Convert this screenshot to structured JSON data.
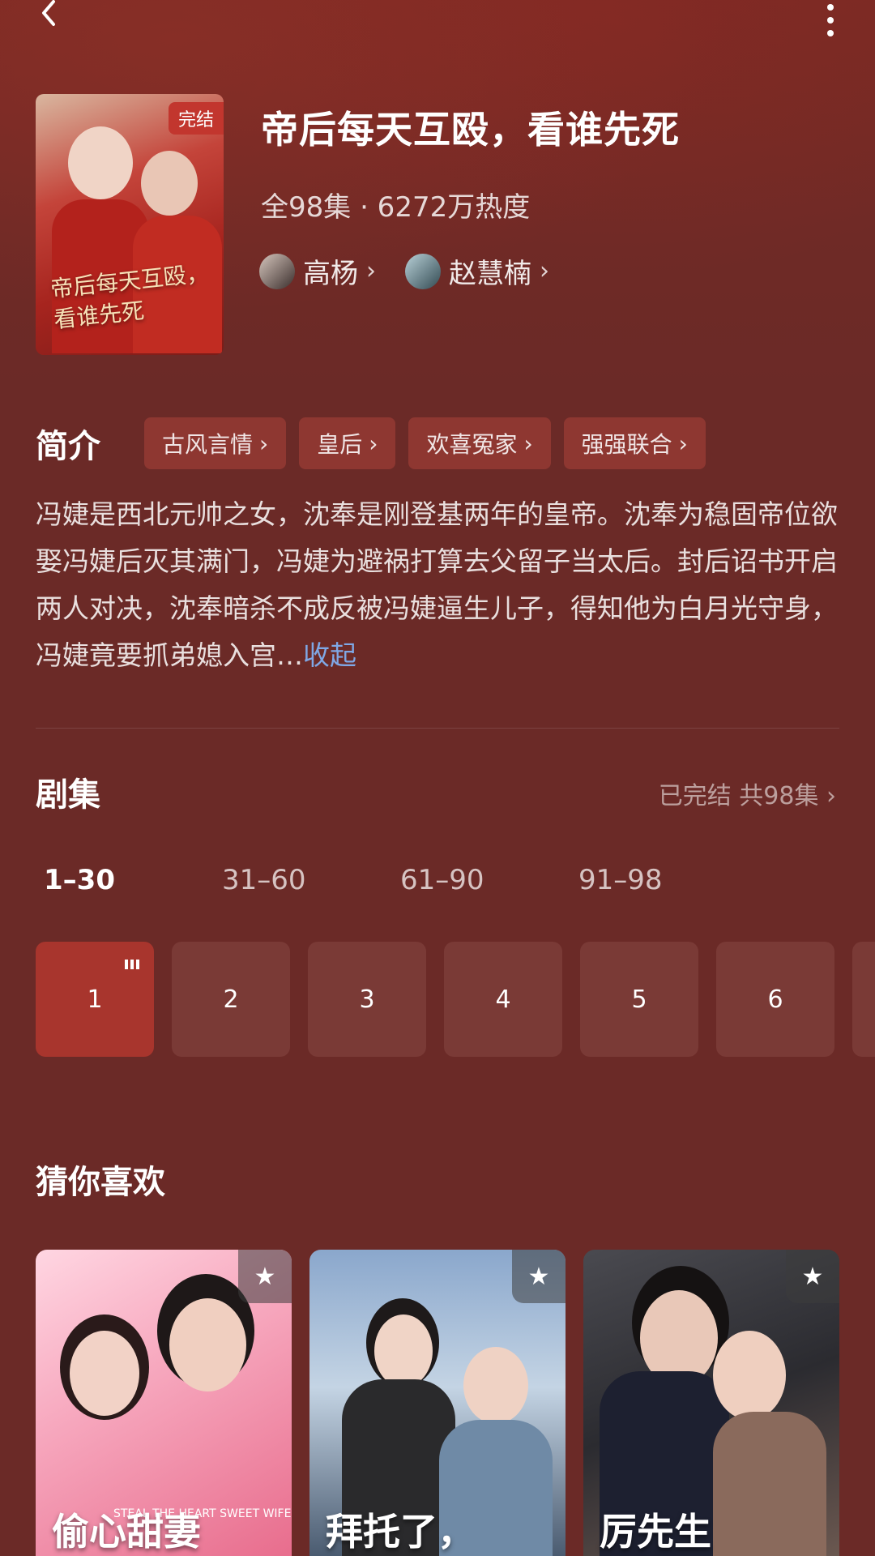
{
  "drama": {
    "title": "帝后每天互殴，看谁先死",
    "meta": "全98集 · 6272万热度",
    "badge": "完结",
    "poster_calligraphy": "帝后每天互殴，看谁先死",
    "actors": [
      {
        "name": "高杨"
      },
      {
        "name": "赵慧楠"
      }
    ]
  },
  "intro": {
    "label": "简介",
    "tags": [
      "古风言情",
      "皇后",
      "欢喜冤家",
      "强强联合"
    ],
    "description": "冯婕是西北元帅之女，沈奉是刚登基两年的皇帝。沈奉为稳固帝位欲娶冯婕后灭其满门，冯婕为避祸打算去父留子当太后。封后诏书开启两人对决，沈奉暗杀不成反被冯婕逼生儿子，得知他为白月光守身，冯婕竟要抓弟媳入宫…",
    "collapse_label": "收起"
  },
  "episodes": {
    "label": "剧集",
    "status": "已完结 共98集",
    "ranges": [
      "1–30",
      "31–60",
      "61–90",
      "91–98"
    ],
    "active_range": "1–30",
    "items": [
      "1",
      "2",
      "3",
      "4",
      "5",
      "6"
    ],
    "playing": "1"
  },
  "recommend": {
    "label": "猜你喜欢",
    "cards": [
      {
        "caption": "偷心甜妻",
        "subtitle": "STEAL THE HEART SWEET WIFE"
      },
      {
        "caption": "拜托了，"
      },
      {
        "caption": "厉先生"
      }
    ]
  },
  "colors": {
    "background": "#6b2a27",
    "accent": "#a8352d",
    "link": "#7fa8e6"
  },
  "icons": [
    "back-arrow-icon",
    "more-vertical-icon",
    "chevron-right-icon",
    "playing-bars-icon",
    "star-icon"
  ]
}
